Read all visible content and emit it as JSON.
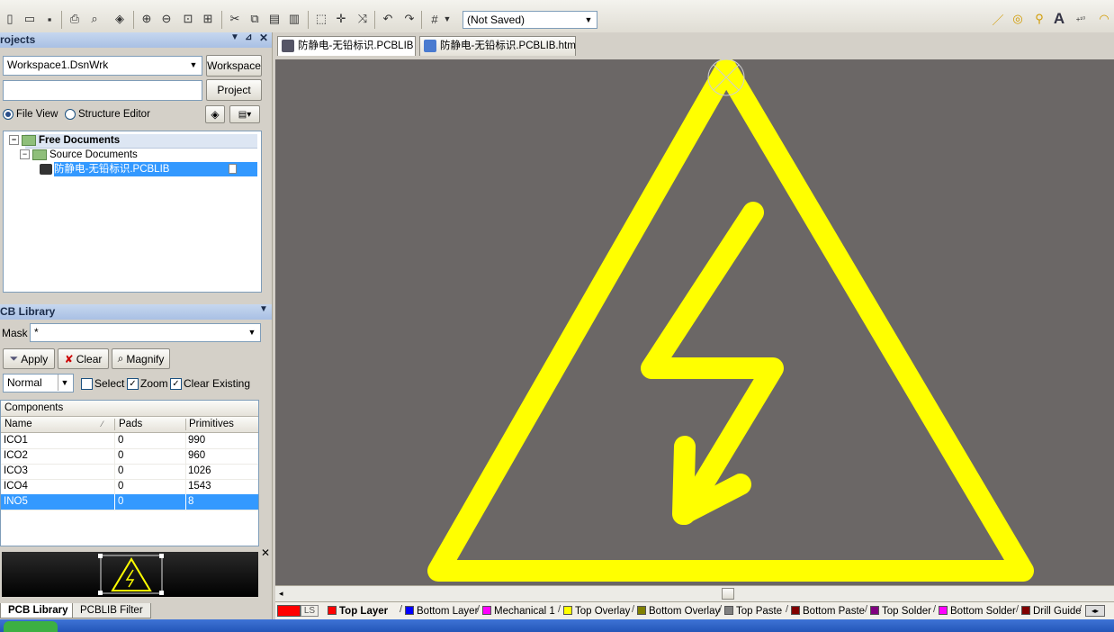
{
  "toolbar": {
    "view_config": "(Not Saved)"
  },
  "projects_panel": {
    "title": "rojects",
    "workspace_value": "Workspace1.DsnWrk",
    "workspace_button": "Workspace",
    "project_value": "",
    "project_button": "Project",
    "file_view_label": "File View",
    "structure_editor_label": "Structure Editor",
    "tree": {
      "free_documents": "Free Documents",
      "source_documents": "Source Documents",
      "file": "防静电-无铅标识.PCBLIB"
    }
  },
  "pcb_library": {
    "title": "CB Library",
    "mask_label": "Mask",
    "mask_value": "*",
    "apply_button": "Apply",
    "clear_button": "Clear",
    "magnify_button": "Magnify",
    "mode_value": "Normal",
    "select_label": "Select",
    "zoom_label": "Zoom",
    "clear_existing_label": "Clear Existing",
    "select_checked": false,
    "zoom_checked": true,
    "clear_existing_checked": true,
    "components_header": "Components",
    "columns": [
      "Name",
      "Pads",
      "Primitives"
    ],
    "rows": [
      {
        "name": "ICO1",
        "pads": "0",
        "primitives": "990",
        "selected": false
      },
      {
        "name": "ICO2",
        "pads": "0",
        "primitives": "960",
        "selected": false
      },
      {
        "name": "ICO3",
        "pads": "0",
        "primitives": "1026",
        "selected": false
      },
      {
        "name": "ICO4",
        "pads": "0",
        "primitives": "1543",
        "selected": false
      },
      {
        "name": "INO5",
        "pads": "0",
        "primitives": "8",
        "selected": true
      }
    ]
  },
  "panel_tabs": [
    "PCB Library",
    "PCBLIB Filter"
  ],
  "doc_tabs": [
    "防静电-无铅标识.PCBLIB",
    "防静电-无铅标识.PCBLIB.htm"
  ],
  "canvas": {
    "background": "#6b6766",
    "symbol_color": "#ffff00"
  },
  "layers": {
    "ls_label": "LS",
    "items": [
      {
        "name": "Top Layer",
        "color": "#ff0000",
        "active": true
      },
      {
        "name": "Bottom Layer",
        "color": "#0000ff",
        "active": false
      },
      {
        "name": "Mechanical 1",
        "color": "#ff00ff",
        "active": false
      },
      {
        "name": "Top Overlay",
        "color": "#ffff00",
        "active": false
      },
      {
        "name": "Bottom Overlay",
        "color": "#808000",
        "active": false
      },
      {
        "name": "Top Paste",
        "color": "#808080",
        "active": false
      },
      {
        "name": "Bottom Paste",
        "color": "#800000",
        "active": false
      },
      {
        "name": "Top Solder",
        "color": "#800080",
        "active": false
      },
      {
        "name": "Bottom Solder",
        "color": "#ff00ff",
        "active": false
      },
      {
        "name": "Drill Guide",
        "color": "#800000",
        "active": false
      }
    ]
  }
}
